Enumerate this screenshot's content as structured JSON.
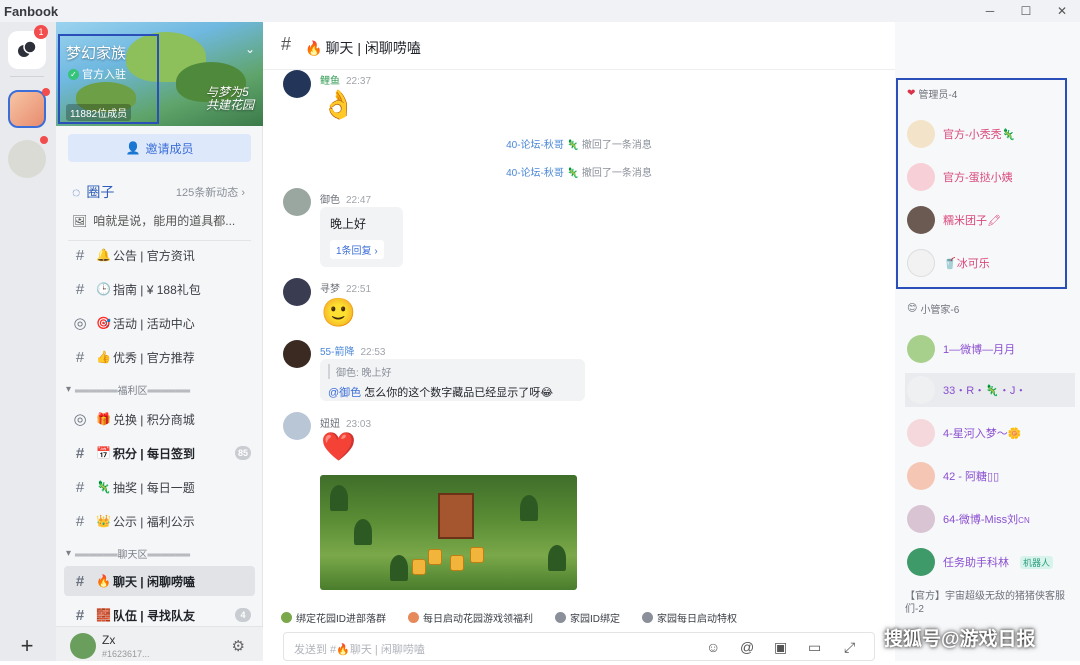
{
  "app": {
    "title": "Fanbook",
    "btn_min": "─",
    "btn_max": "☐",
    "btn_close": "✕"
  },
  "rail": {
    "notif_count": "1",
    "add_label": "+"
  },
  "server": {
    "name": "梦幻家族",
    "official": "官方入驻",
    "members": "11882位成员",
    "slogan": "与梦为5 共建花园",
    "invite": "邀请成员"
  },
  "circle": {
    "title": "圈子",
    "count": "125条新动态",
    "preview": "咱就是说，能用的道具都..."
  },
  "channels": [
    {
      "emoji": "🔔",
      "name": "公告 | 官方资讯",
      "type": "#"
    },
    {
      "emoji": "🕒",
      "name": "指南 | ¥ 188礼包",
      "type": "#"
    },
    {
      "emoji": "🎯",
      "name": "活动 | 活动中心",
      "type": "◎"
    },
    {
      "emoji": "👍",
      "name": "优秀 | 官方推荐",
      "type": "#"
    }
  ],
  "cat1": "══════福利区══════",
  "channels2": [
    {
      "emoji": "🎁",
      "name": "兑换 | 积分商城",
      "type": "◎",
      "unread": ""
    },
    {
      "emoji": "📅",
      "name": "积分 | 每日签到",
      "type": "#",
      "unread": "85"
    },
    {
      "emoji": "🦎",
      "name": "抽奖 | 每日一题",
      "type": "#",
      "unread": ""
    },
    {
      "emoji": "👑",
      "name": "公示 | 福利公示",
      "type": "#",
      "unread": ""
    }
  ],
  "cat2": "══════聊天区══════",
  "channels3": [
    {
      "emoji": "🔥",
      "name": "聊天 | 闲聊唠嗑",
      "type": "#",
      "unread": ""
    },
    {
      "emoji": "🧱",
      "name": "队伍 | 寻找队友",
      "type": "#",
      "unread": "4"
    }
  ],
  "user": {
    "name": "Zx",
    "id": "#1623617..."
  },
  "chat": {
    "title_emoji": "🔥",
    "title": "聊天 | 闲聊唠嗑",
    "m1": {
      "name": "鲤鱼",
      "time": "22:37",
      "emoji": "👌"
    },
    "sys1": {
      "who": "40-论坛-秋哥",
      "action": "撤回了一条消息"
    },
    "sys2": {
      "who": "40-论坛-秋哥",
      "action": "撤回了一条消息"
    },
    "m2": {
      "name": "御色",
      "time": "22:47",
      "text": "晚上好",
      "reply": "1条回复 ›"
    },
    "m3": {
      "name": "寻梦",
      "time": "22:51",
      "emoji": "🙂"
    },
    "m4": {
      "name": "55-箭降",
      "time": "22:53",
      "quote": "御色: 晚上好",
      "mention": "@御色",
      "text": " 怎么你的这个数字藏品已经显示了呀😂"
    },
    "m5": {
      "name": "妞妞",
      "time": "23:03",
      "emoji": "❤️"
    },
    "quick": [
      "绑定花园ID进部落群",
      "每日启动花园游戏领福利",
      "家园ID绑定",
      "家园每日启动特权"
    ],
    "placeholder": "发送到 #🔥聊天 | 闲聊唠嗑"
  },
  "members": {
    "admin_head": "管理员-4",
    "admins": [
      {
        "name": "官方-小秃秃",
        "suffix": "🦎",
        "color": "pink"
      },
      {
        "name": "官方-蛋挞小姨",
        "suffix": "",
        "color": "pink"
      },
      {
        "name": "糯米团子",
        "suffix": "🖍",
        "color": "pink"
      },
      {
        "name": "冰可乐",
        "prefix": "🥤",
        "suffix": "",
        "color": "pink"
      }
    ],
    "helper_head": "小管家-6",
    "helpers": [
      {
        "name": "1—微博—月月",
        "suffix": "",
        "color": "purple",
        "bot": ""
      },
      {
        "name": "33・R・",
        "suffix": "🦎・J・",
        "color": "purple",
        "bot": ""
      },
      {
        "name": "4-星河入梦～",
        "suffix": "🌼",
        "color": "purple",
        "bot": ""
      },
      {
        "name": "42 - 阿糖▯▯",
        "suffix": "",
        "color": "purple",
        "bot": ""
      },
      {
        "name": "64-微博-Miss刘",
        "suffix": "CN",
        "color": "purple",
        "bot": ""
      },
      {
        "name": "任务助手科林",
        "suffix": "",
        "color": "purple",
        "bot": "机器人"
      }
    ],
    "notice": "【官方】宇宙超级无敌的猪猪侠客服们-2"
  },
  "watermark": "搜狐号@游戏日报"
}
